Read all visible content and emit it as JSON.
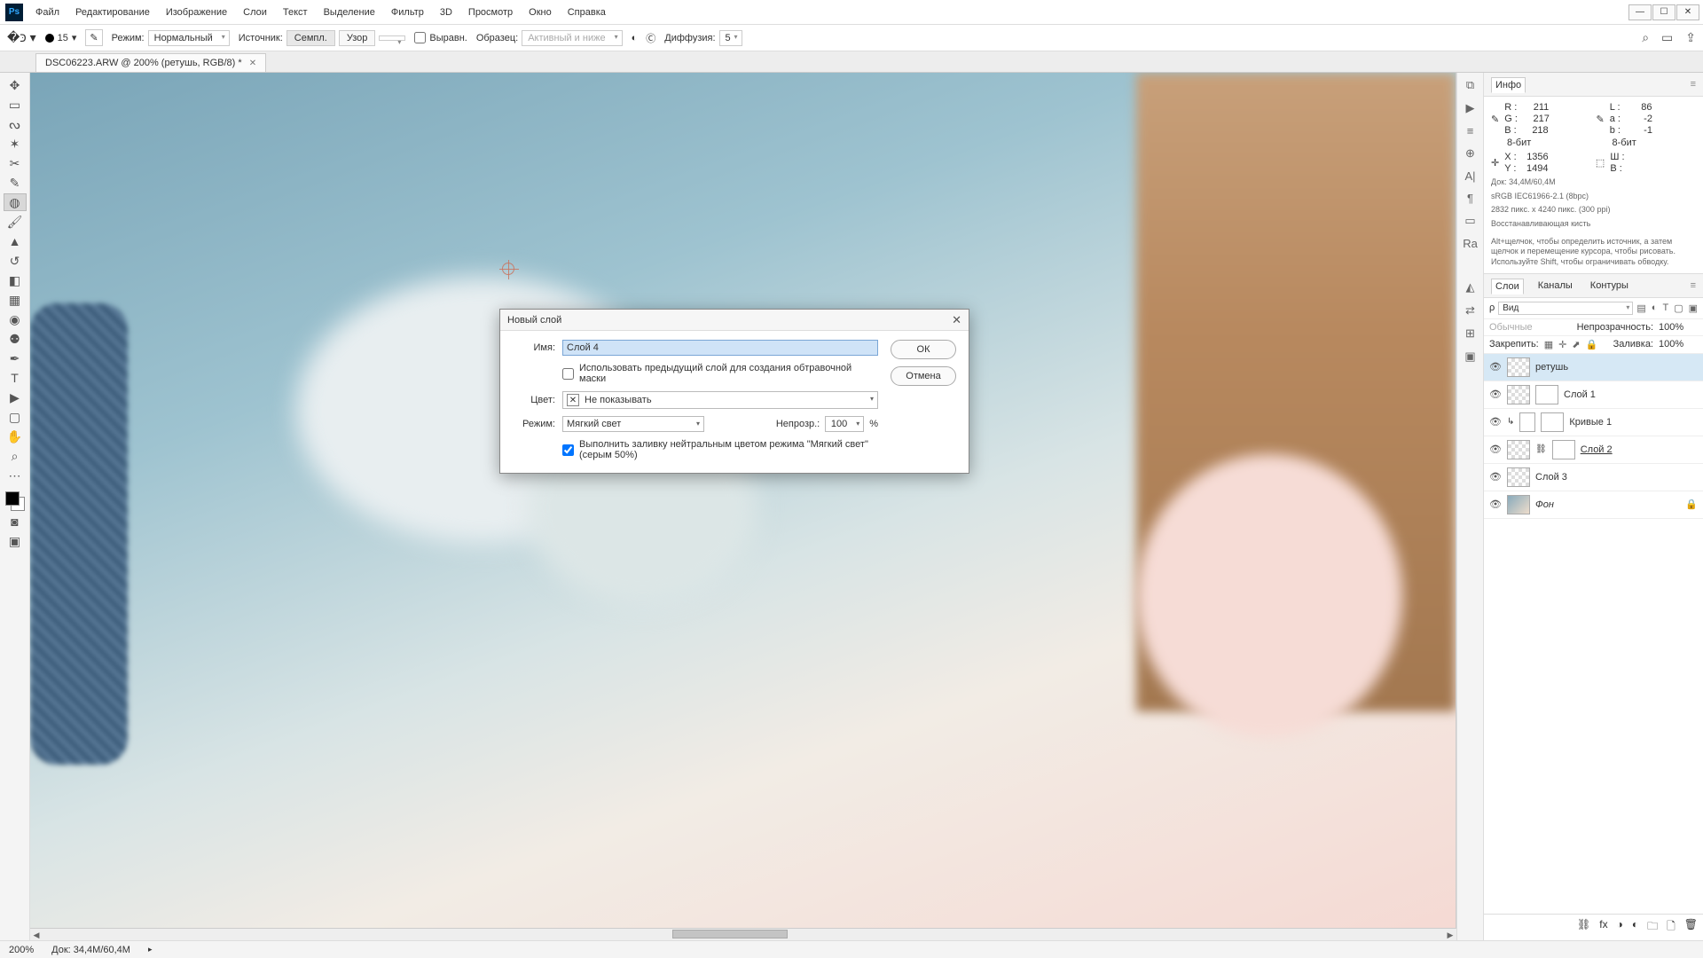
{
  "menu": [
    "Файл",
    "Редактирование",
    "Изображение",
    "Слои",
    "Текст",
    "Выделение",
    "Фильтр",
    "3D",
    "Просмотр",
    "Окно",
    "Справка"
  ],
  "options": {
    "brush_size": "15",
    "mode_label": "Режим:",
    "mode_value": "Нормальный",
    "source_label": "Источник:",
    "btn_sample": "Семпл.",
    "btn_pattern": "Узор",
    "aligned": "Выравн.",
    "sample_label": "Образец:",
    "sample_value": "Активный и ниже",
    "diffusion_label": "Диффузия:",
    "diffusion_value": "5"
  },
  "tab": {
    "title": "DSC06223.ARW @ 200% (ретушь, RGB/8) *"
  },
  "info": {
    "title": "Инфо",
    "R": "R :",
    "G": "G :",
    "B": "B :",
    "Rv": "211",
    "Gv": "217",
    "Bv": "218",
    "L": "L :",
    "a": "a :",
    "b": "b :",
    "Lv": "86",
    "av": "-2",
    "bv": "-1",
    "bit": "8-бит",
    "X": "X :",
    "Y": "Y :",
    "Xv": "1356",
    "Yv": "1494",
    "W": "Ш :",
    "H": "В :",
    "Wv": "",
    "Hv": "",
    "doc": "Док: 34,4M/60,4M",
    "profile": "sRGB IEC61966-2.1 (8bpc)",
    "dims": "2832 пикс. x 4240 пикс. (300 ppi)",
    "tool": "Восстанавливающая кисть",
    "hint": "Alt+щелчок, чтобы определить источник, а затем щелчок и перемещение курсора, чтобы рисовать. Используйте Shift, чтобы ограничивать обводку."
  },
  "layersPanel": {
    "tabs": [
      "Слои",
      "Каналы",
      "Контуры"
    ],
    "kind": "Вид",
    "blend": "Обычные",
    "opacity_label": "Непрозрачность:",
    "opacity": "100%",
    "lock_label": "Закрепить:",
    "fill_label": "Заливка:",
    "fill": "100%",
    "layers": [
      {
        "name": "ретушь",
        "sel": true
      },
      {
        "name": "Слой 1"
      },
      {
        "name": "Кривые 1",
        "adj": true
      },
      {
        "name": "Слой 2",
        "link": true,
        "underline": true
      },
      {
        "name": "Слой 3"
      },
      {
        "name": "Фон",
        "locked": true,
        "img": true
      }
    ]
  },
  "status": {
    "zoom": "200%",
    "doc": "Док: 34,4M/60,4M"
  },
  "dialog": {
    "title": "Новый слой",
    "name_label": "Имя:",
    "name_value": "Слой 4",
    "clip": "Использовать предыдущий слой для создания обтравочной маски",
    "color_label": "Цвет:",
    "color_value": "Не показывать",
    "mode_label": "Режим:",
    "mode_value": "Мягкий свет",
    "opacity_label": "Непрозр.:",
    "opacity_value": "100",
    "pct": "%",
    "fill_neutral": "Выполнить заливку нейтральным цветом режима \"Мягкий свет\"  (серым 50%)",
    "ok": "ОК",
    "cancel": "Отмена"
  }
}
